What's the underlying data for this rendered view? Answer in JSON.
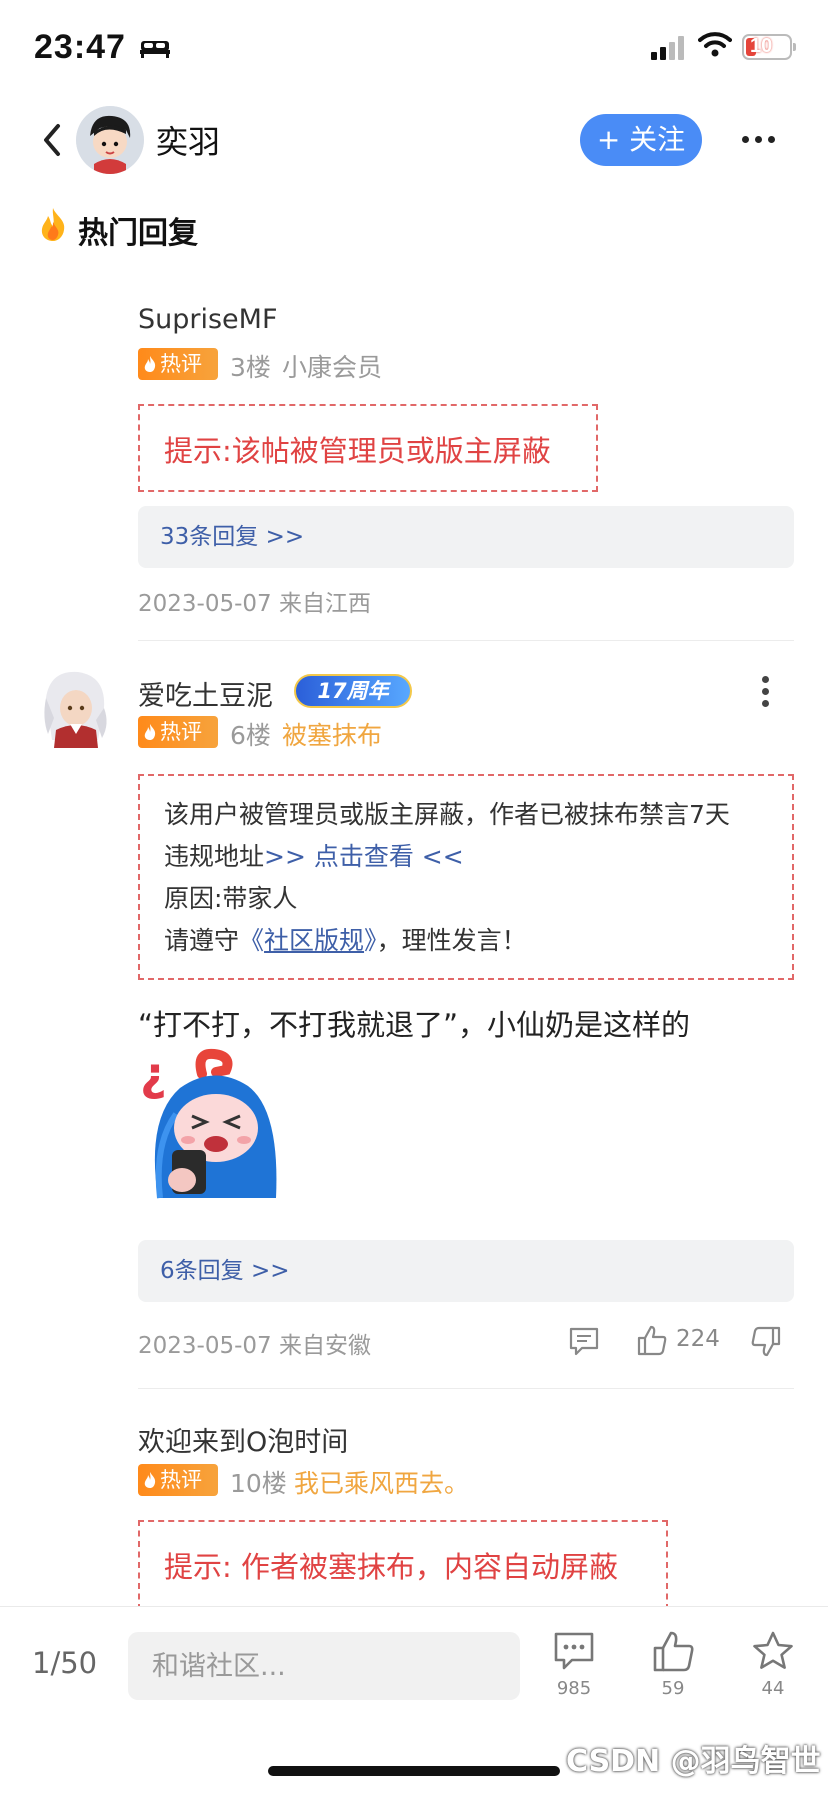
{
  "status_bar": {
    "time": "23:47",
    "battery": "10"
  },
  "header": {
    "author": "奕羽",
    "follow_label": "+ 关注"
  },
  "section": {
    "title": "热门回复"
  },
  "comments": [
    {
      "username": "SupriseMF",
      "badge": "热评",
      "floor": "3楼",
      "level": "小康会员",
      "notice": "提示:该帖被管理员或版主屏蔽",
      "replies": "33条回复 >>",
      "date": "2023-05-07 来自江西"
    },
    {
      "username": "爱吃土豆泥",
      "anniversary_badge": "17周年",
      "badge": "热评",
      "floor": "6楼",
      "level": "被塞抹布",
      "ban_notice": {
        "line1": "该用户被管理员或版主屏蔽，作者已被抹布禁言7天",
        "line2_prefix": "违规地址",
        "line2_link": ">> 点击查看 <<",
        "line3": "原因:带家人",
        "line4_prefix": "请遵守",
        "line4_link_open": "《",
        "line4_link": "社区版规",
        "line4_link_close": "》",
        "line4_suffix": "，理性发言！"
      },
      "text": "“打不打，不打我就退了”，小仙奶是这样的",
      "replies": "6条回复 >>",
      "date": "2023-05-07 来自安徽",
      "likes": "224"
    },
    {
      "username": "欢迎来到O泡时间",
      "badge": "热评",
      "floor": "10楼",
      "level": "我已乘风西去。",
      "notice": "提示: 作者被塞抹布，内容自动屏蔽"
    }
  ],
  "bottom_bar": {
    "page": "1/50",
    "input_placeholder": "和谐社区...",
    "comments_count": "985",
    "likes_count": "59",
    "favorites_count": "44"
  },
  "watermark": "CSDN @羽鸟智世",
  "colors": {
    "accent": "#4a8cf6",
    "hot": "#ff8a1a",
    "notice_red": "#e04343",
    "link": "#3e5fa8"
  }
}
